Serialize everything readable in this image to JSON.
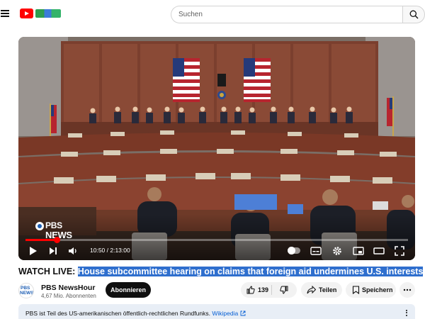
{
  "header": {
    "search_placeholder": "Suchen"
  },
  "player": {
    "time_current": "10:50",
    "time_total": "2:13:00",
    "time_display": "10:50 / 2:13:00",
    "progress": 0.082,
    "overlay_logo_top": "PBS",
    "overlay_logo_bottom": "NEWS"
  },
  "video": {
    "title_prefix": "WATCH LIVE: ",
    "title_selected": "House subcommittee hearing on claims that foreign aid undermines U.S. interests"
  },
  "channel": {
    "name": "PBS NewsHour",
    "subscribers": "4,67 Mio. Abonnenten",
    "avatar_top": "PBS",
    "avatar_bottom": "NEWS",
    "subscribe_label": "Abonnieren"
  },
  "actions": {
    "like_count": "139",
    "share_label": "Teilen",
    "save_label": "Speichern"
  },
  "description": {
    "text": "PBS ist Teil des US-amerikanischen öffentlich-rechtlichen Rundfunks.",
    "link_label": "Wikipedia",
    "link_icon": "external-link-icon"
  },
  "colors": {
    "brand_red": "#ff0000",
    "selection_highlight": "#2f6fce",
    "link_blue": "#065fd4",
    "subscribe_bg": "#0f0f0f"
  }
}
